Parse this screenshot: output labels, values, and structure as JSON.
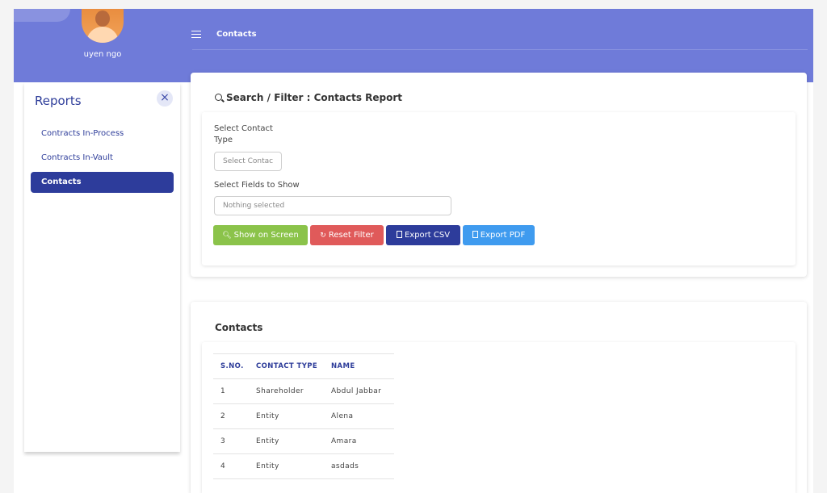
{
  "user": {
    "name": "uyen ngo"
  },
  "header": {
    "title": "Contacts"
  },
  "sidebar": {
    "title": "Reports",
    "items": [
      {
        "label": "Contracts In-Process",
        "active": false
      },
      {
        "label": "Contracts In-Vault",
        "active": false
      },
      {
        "label": "Contacts",
        "active": true
      }
    ]
  },
  "filter": {
    "title": "Search / Filter : Contacts Report",
    "contact_type_label": "Select Contact Type",
    "contact_type_placeholder": "Select Contac",
    "fields_label": "Select Fields to Show",
    "fields_placeholder": "Nothing selected",
    "buttons": {
      "show": "Show on Screen",
      "reset": "Reset Filter",
      "csv": "Export CSV",
      "pdf": "Export PDF"
    }
  },
  "results": {
    "title": "Contacts",
    "columns": [
      "S.NO.",
      "CONTACT TYPE",
      "NAME"
    ],
    "rows": [
      [
        "1",
        "Shareholder",
        "Abdul Jabbar"
      ],
      [
        "2",
        "Entity",
        "Alena"
      ],
      [
        "3",
        "Entity",
        "Amara"
      ],
      [
        "4",
        "Entity",
        "asdads"
      ]
    ]
  },
  "colors": {
    "header_bg": "#6f7bd9",
    "accent": "#2d3c9b",
    "green": "#8bc34a",
    "red": "#e05a5a",
    "blue": "#3f9bef"
  }
}
